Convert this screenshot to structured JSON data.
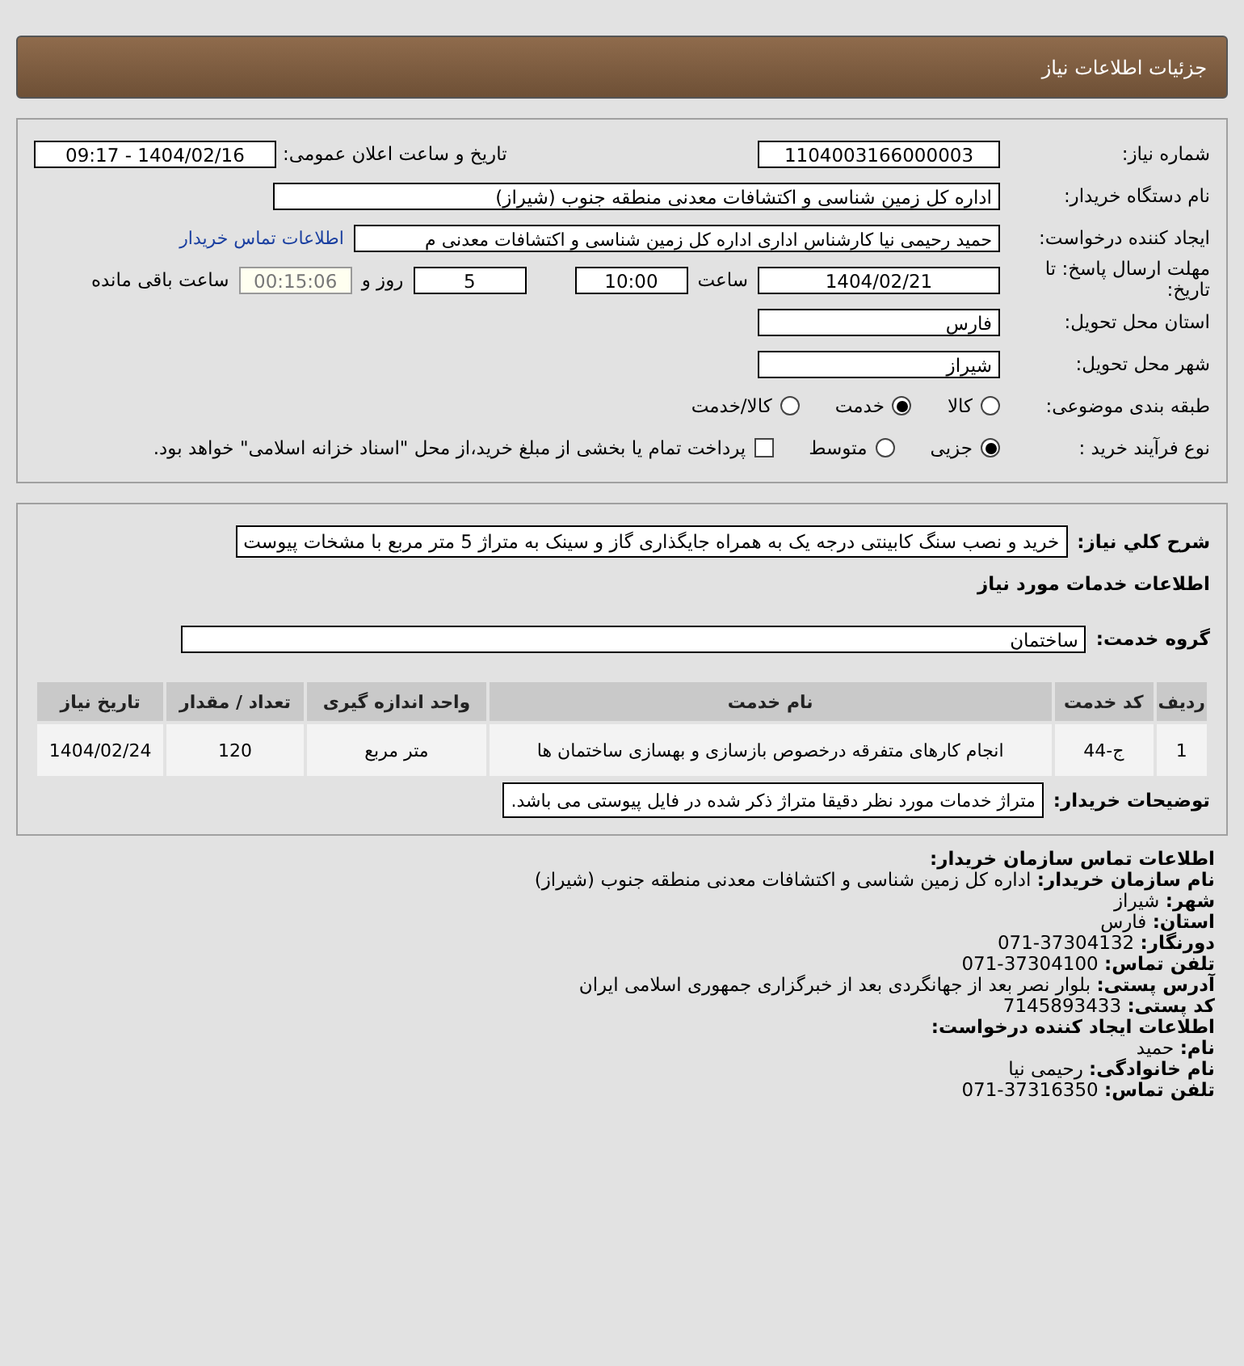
{
  "header": {
    "title": "جزئیات اطلاعات نیاز"
  },
  "need_number": {
    "label": "شماره نیاز:",
    "value": "1104003166000003"
  },
  "announce": {
    "label": "تاریخ و ساعت اعلان عمومی:",
    "value": "1404/02/16 - 09:17"
  },
  "buyer": {
    "label": "نام دستگاه خریدار:",
    "value": "اداره کل زمین شناسی و اکتشافات معدنی منطقه جنوب (شیراز)"
  },
  "creator": {
    "label": "ایجاد کننده درخواست:",
    "value": "حمید رحیمی نیا کارشناس اداری اداره کل زمین شناسی و اکتشافات معدنی م",
    "link": "اطلاعات تماس خریدار"
  },
  "deadline": {
    "label": "مهلت ارسال پاسخ: تا تاریخ:",
    "date": "1404/02/21",
    "time_label": "ساعت",
    "time": "10:00",
    "days": "5",
    "days_label": "روز و",
    "remaining": "00:15:06",
    "remaining_label": "ساعت باقی مانده"
  },
  "province": {
    "label": "استان محل تحویل:",
    "value": "فارس"
  },
  "city": {
    "label": "شهر محل تحویل:",
    "value": "شیراز"
  },
  "category": {
    "label": "طبقه بندی موضوعی:",
    "options": [
      {
        "label": "کالا",
        "selected": false
      },
      {
        "label": "خدمت",
        "selected": true
      },
      {
        "label": "کالا/خدمت",
        "selected": false
      }
    ]
  },
  "process": {
    "label": "نوع فرآیند خرید :",
    "options": [
      {
        "label": "جزیی",
        "selected": true
      },
      {
        "label": "متوسط",
        "selected": false
      }
    ],
    "checkbox": {
      "checked": false,
      "label": "پرداخت تمام یا بخشی از مبلغ خرید،از محل \"اسناد خزانه اسلامی\" خواهد بود."
    }
  },
  "description": {
    "label": "شرح کلي نیاز:",
    "value": "خرید و نصب سنگ کابینتی درجه یک به همراه جایگذاری گاز و سینک به متراژ 5 متر مربع با مشخات پیوست"
  },
  "services_title": "اطلاعات خدمات مورد نیاز",
  "service_group": {
    "label": "گروه خدمت:",
    "value": "ساختمان"
  },
  "table": {
    "columns": [
      "ردیف",
      "کد خدمت",
      "نام خدمت",
      "واحد اندازه گیری",
      "تعداد / مقدار",
      "تاریخ نیاز"
    ],
    "rows": [
      [
        "1",
        "ج-44",
        "انجام کارهای متفرقه درخصوص بازسازی و بهسازی ساختمان ها",
        "متر مربع",
        "120",
        "1404/02/24"
      ]
    ]
  },
  "buyer_notes": {
    "label": "توضیحات خریدار:",
    "value": "متراژ خدمات مورد نظر دقیقا متراژ ذکر شده در فایل پیوستی می باشد."
  },
  "contact": [
    {
      "kind": "heading",
      "label": "اطلاعات تماس سازمان خریدار:"
    },
    {
      "kind": "line",
      "label": "نام سازمان خریدار:",
      "value": "اداره کل زمین شناسی و اکتشافات معدنی منطقه جنوب (شیراز)"
    },
    {
      "kind": "line",
      "label": "شهر:",
      "value": "شیراز"
    },
    {
      "kind": "line",
      "label": "استان:",
      "value": "فارس"
    },
    {
      "kind": "line",
      "label": "دورنگار:",
      "value": "37304132-071"
    },
    {
      "kind": "line",
      "label": "تلفن تماس:",
      "value": "37304100-071"
    },
    {
      "kind": "line",
      "label": "آدرس پستی:",
      "value": "بلوار نصر بعد از جهانگردی بعد از خبرگزاری جمهوری اسلامی ایران"
    },
    {
      "kind": "line",
      "label": "کد پستی:",
      "value": "7145893433"
    },
    {
      "kind": "heading",
      "label": "اطلاعات ایجاد کننده درخواست:"
    },
    {
      "kind": "line",
      "label": "نام:",
      "value": "حمید"
    },
    {
      "kind": "line",
      "label": "نام خانوادگی:",
      "value": "رحیمی نیا"
    },
    {
      "kind": "line",
      "label": "تلفن تماس:",
      "value": "37316350-071"
    }
  ]
}
